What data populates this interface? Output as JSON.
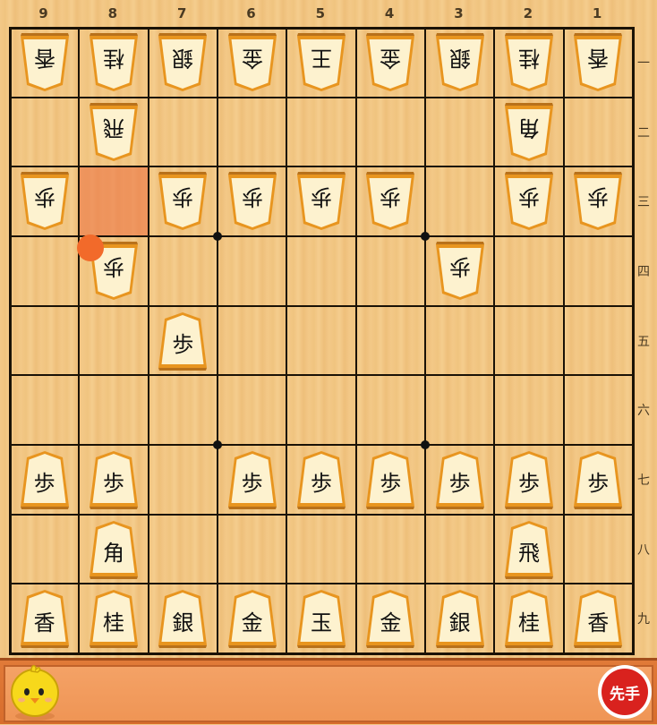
{
  "files": [
    "9",
    "8",
    "7",
    "6",
    "5",
    "4",
    "3",
    "2",
    "1"
  ],
  "ranks": [
    "一",
    "二",
    "三",
    "四",
    "五",
    "六",
    "七",
    "八",
    "九"
  ],
  "highlight_square": {
    "file": 8,
    "rank": 3
  },
  "selected_square": {
    "file": 8,
    "rank": 4
  },
  "pieces": [
    {
      "file": 9,
      "rank": 1,
      "char": "香",
      "side": "gote"
    },
    {
      "file": 8,
      "rank": 1,
      "char": "桂",
      "side": "gote"
    },
    {
      "file": 7,
      "rank": 1,
      "char": "銀",
      "side": "gote"
    },
    {
      "file": 6,
      "rank": 1,
      "char": "金",
      "side": "gote"
    },
    {
      "file": 5,
      "rank": 1,
      "char": "王",
      "side": "gote"
    },
    {
      "file": 4,
      "rank": 1,
      "char": "金",
      "side": "gote"
    },
    {
      "file": 3,
      "rank": 1,
      "char": "銀",
      "side": "gote"
    },
    {
      "file": 2,
      "rank": 1,
      "char": "桂",
      "side": "gote"
    },
    {
      "file": 1,
      "rank": 1,
      "char": "香",
      "side": "gote"
    },
    {
      "file": 8,
      "rank": 2,
      "char": "飛",
      "side": "gote"
    },
    {
      "file": 2,
      "rank": 2,
      "char": "角",
      "side": "gote"
    },
    {
      "file": 9,
      "rank": 3,
      "char": "歩",
      "side": "gote"
    },
    {
      "file": 7,
      "rank": 3,
      "char": "歩",
      "side": "gote"
    },
    {
      "file": 6,
      "rank": 3,
      "char": "歩",
      "side": "gote"
    },
    {
      "file": 5,
      "rank": 3,
      "char": "歩",
      "side": "gote"
    },
    {
      "file": 4,
      "rank": 3,
      "char": "歩",
      "side": "gote"
    },
    {
      "file": 2,
      "rank": 3,
      "char": "歩",
      "side": "gote"
    },
    {
      "file": 1,
      "rank": 3,
      "char": "歩",
      "side": "gote"
    },
    {
      "file": 8,
      "rank": 4,
      "char": "歩",
      "side": "gote"
    },
    {
      "file": 3,
      "rank": 4,
      "char": "歩",
      "side": "gote"
    },
    {
      "file": 7,
      "rank": 5,
      "char": "歩",
      "side": "sente"
    },
    {
      "file": 9,
      "rank": 7,
      "char": "歩",
      "side": "sente"
    },
    {
      "file": 8,
      "rank": 7,
      "char": "歩",
      "side": "sente"
    },
    {
      "file": 6,
      "rank": 7,
      "char": "歩",
      "side": "sente"
    },
    {
      "file": 5,
      "rank": 7,
      "char": "歩",
      "side": "sente"
    },
    {
      "file": 4,
      "rank": 7,
      "char": "歩",
      "side": "sente"
    },
    {
      "file": 3,
      "rank": 7,
      "char": "歩",
      "side": "sente"
    },
    {
      "file": 2,
      "rank": 7,
      "char": "歩",
      "side": "sente"
    },
    {
      "file": 1,
      "rank": 7,
      "char": "歩",
      "side": "sente"
    },
    {
      "file": 8,
      "rank": 8,
      "char": "角",
      "side": "sente"
    },
    {
      "file": 2,
      "rank": 8,
      "char": "飛",
      "side": "sente"
    },
    {
      "file": 9,
      "rank": 9,
      "char": "香",
      "side": "sente"
    },
    {
      "file": 8,
      "rank": 9,
      "char": "桂",
      "side": "sente"
    },
    {
      "file": 7,
      "rank": 9,
      "char": "銀",
      "side": "sente"
    },
    {
      "file": 6,
      "rank": 9,
      "char": "金",
      "side": "sente"
    },
    {
      "file": 5,
      "rank": 9,
      "char": "玉",
      "side": "sente"
    },
    {
      "file": 4,
      "rank": 9,
      "char": "金",
      "side": "sente"
    },
    {
      "file": 3,
      "rank": 9,
      "char": "銀",
      "side": "sente"
    },
    {
      "file": 2,
      "rank": 9,
      "char": "桂",
      "side": "sente"
    },
    {
      "file": 1,
      "rank": 9,
      "char": "香",
      "side": "sente"
    }
  ],
  "turn_badge": {
    "label": "先手"
  },
  "opponent_avatar": {
    "icon": "chick-icon"
  },
  "colors": {
    "board": "#f3c887",
    "highlight": "#ec7646",
    "cursor": "#f26a2a",
    "piece_face": "#fdf2cf",
    "piece_rim": "#e8951f",
    "tray": "#ef9555",
    "turn_badge": "#d9221e"
  }
}
